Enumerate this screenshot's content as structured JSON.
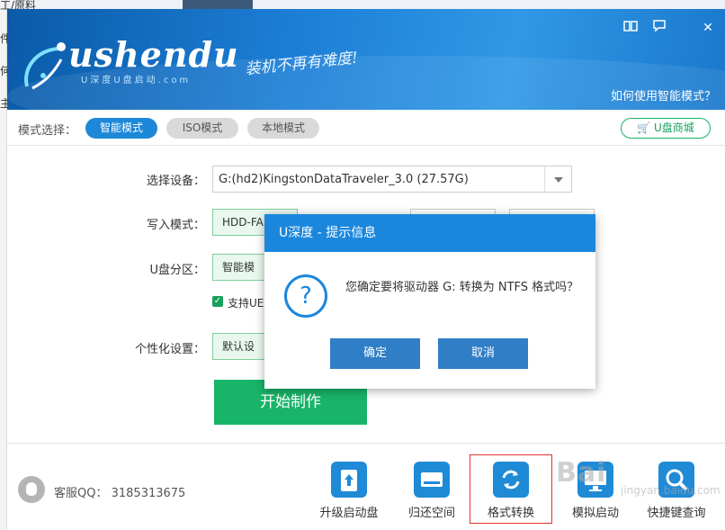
{
  "background": {
    "fragments": [
      "工/原料",
      "件",
      "何",
      "主"
    ]
  },
  "window": {
    "brand": "ushendu",
    "brand_sub": "U深度U盘启动.com",
    "slogan": "装机不再有难度!",
    "help_link": "如何使用智能模式？",
    "controls": {
      "manual_icon": "book-icon",
      "feedback_icon": "chat-icon",
      "close_icon": "close-icon"
    }
  },
  "modebar": {
    "label": "模式选择：",
    "modes": [
      {
        "label": "智能模式",
        "active": true
      },
      {
        "label": "ISO模式",
        "active": false
      },
      {
        "label": "本地模式",
        "active": false
      }
    ],
    "shop_label": "U盘商城",
    "accent": "#1d87d8",
    "shop_color": "#17a05e"
  },
  "form": {
    "device_label": "选择设备：",
    "device_value": "G:(hd2)KingstonDataTraveler_3.0 (27.57G)",
    "write_mode_label": "写入模式：",
    "write_mode_value": "HDD-FA",
    "partition_label": "U盘分区：",
    "partition_value": "智能模",
    "uefi_label": "支持UE",
    "personal_label": "个性化设置：",
    "personal_value": "默认设",
    "start_label": "开始制作",
    "start_color": "#18b468"
  },
  "footer": {
    "qq_label": "客服QQ：",
    "qq_number": "3185313675",
    "tools": [
      {
        "label": "升级启动盘",
        "icon": "upload-icon"
      },
      {
        "label": "归还空间",
        "icon": "drive-icon"
      },
      {
        "label": "格式转换",
        "icon": "convert-icon",
        "selected": true
      },
      {
        "label": "模拟启动",
        "icon": "monitor-icon"
      },
      {
        "label": "快捷键查询",
        "icon": "magnifier-icon"
      }
    ]
  },
  "dialog": {
    "title": "U深度 - 提示信息",
    "message": "您确定要将驱动器 G: 转换为 NTFS 格式吗？",
    "icon": "question-icon",
    "ok_label": "确定",
    "cancel_label": "取消"
  },
  "watermark": {
    "text": "Bai",
    "sub": "jingyan.baidu.com"
  }
}
